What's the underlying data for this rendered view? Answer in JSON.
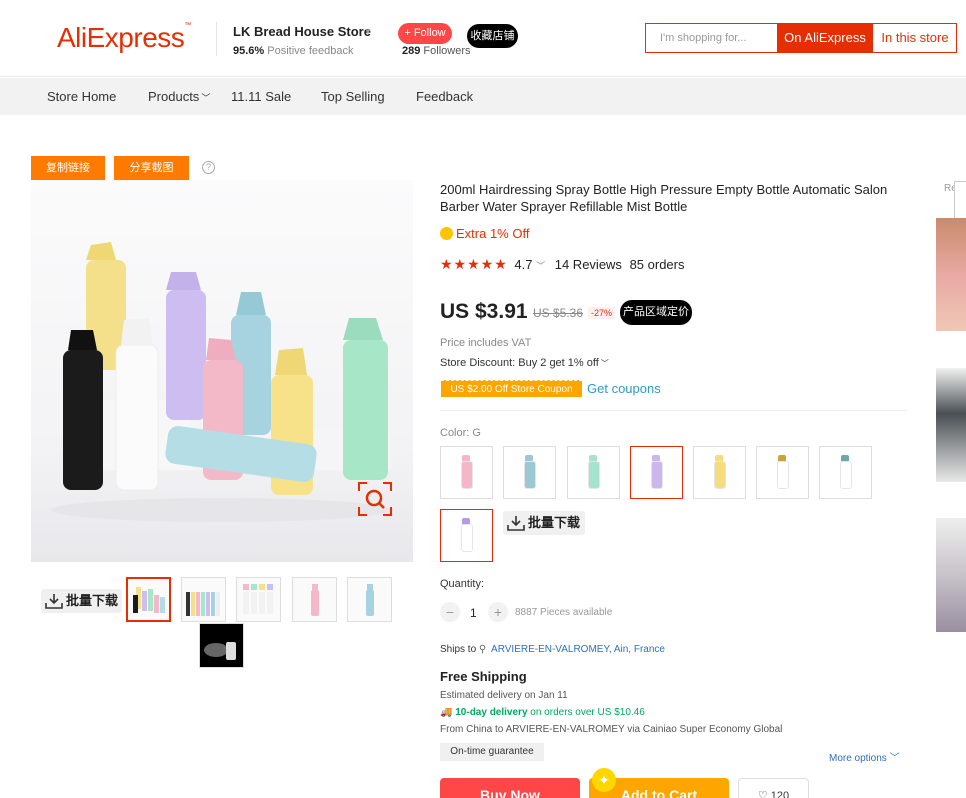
{
  "header": {
    "logo": "AliExpress",
    "store_name": "LK Bread House Store",
    "feedback_pct": "95.6%",
    "feedback_label": "Positive feedback",
    "follow_label": "+ Follow",
    "followers_count": "289",
    "followers_label": "Followers",
    "favorite_store_label": "收藏店铺",
    "search_placeholder": "I'm shopping for...",
    "search_ali_label": "On AliExpress",
    "search_store_label": "In this store"
  },
  "nav": {
    "items": [
      "Store Home",
      "Products",
      "11.11 Sale",
      "Top Selling",
      "Feedback"
    ]
  },
  "gallery": {
    "copy_link_label": "复制链接",
    "share_label": "分享截图",
    "batch_download_label": "批量下载"
  },
  "product": {
    "title": "200ml Hairdressing Spray Bottle High Pressure Empty Bottle Automatic Salon Barber Water Sprayer Refillable Mist Bottle",
    "extra_off": "Extra 1% Off",
    "stars": "★★★★★",
    "rating": "4.7",
    "reviews": "14 Reviews",
    "orders": "85 orders",
    "price": "US $3.91",
    "original_price": "US $5.36",
    "discount": "-27%",
    "region_price_label": "产品区域定价",
    "vat_note": "Price includes VAT",
    "store_discount": "Store Discount: Buy 2 get 1% off",
    "coupon": "US $2.00 Off Store Coupon",
    "get_coupons": "Get coupons",
    "color_label": "Color:",
    "color_value": "G",
    "swatch_colors": [
      "#f4b6c8",
      "#9cc7d4",
      "#a6e3cf",
      "#c9b7ee",
      "#f7dc7d",
      "#ffffff",
      "#ffffff",
      "#ffffff"
    ],
    "swatch_nozzles": [
      "#f4b6c8",
      "#9cc7d4",
      "#a6e3cf",
      "#c9b7ee",
      "#f7dc7d",
      "#c9a43b",
      "#6fa6a8",
      "#b59be0"
    ],
    "quantity_label": "Quantity:",
    "quantity_value": "1",
    "quantity_available": "8887 Pieces available",
    "ships_to_label": "Ships to",
    "ships_to_location": "ARVIERE-EN-VALROMEY, Ain, France",
    "free_shipping": "Free Shipping",
    "estimated_delivery": "Estimated delivery on Jan 11",
    "ten_day_bold": "10-day delivery",
    "ten_day_rest": "on orders over US $10.46",
    "from_china": "From China to ARVIERE-EN-VALROMEY via Cainiao Super Economy Global",
    "guarantee": "On-time guarantee",
    "more_options": "More options",
    "buy_now": "Buy Now",
    "add_to_cart": "Add to Cart",
    "wishlist_count": "120"
  },
  "side": {
    "rec_label": "Re"
  },
  "colors": {
    "brand": "#e62e04",
    "accent_orange": "#ff7a00",
    "coupon_orange": "#ffa500",
    "link_blue": "#2e9cc3",
    "green": "#00a862"
  }
}
